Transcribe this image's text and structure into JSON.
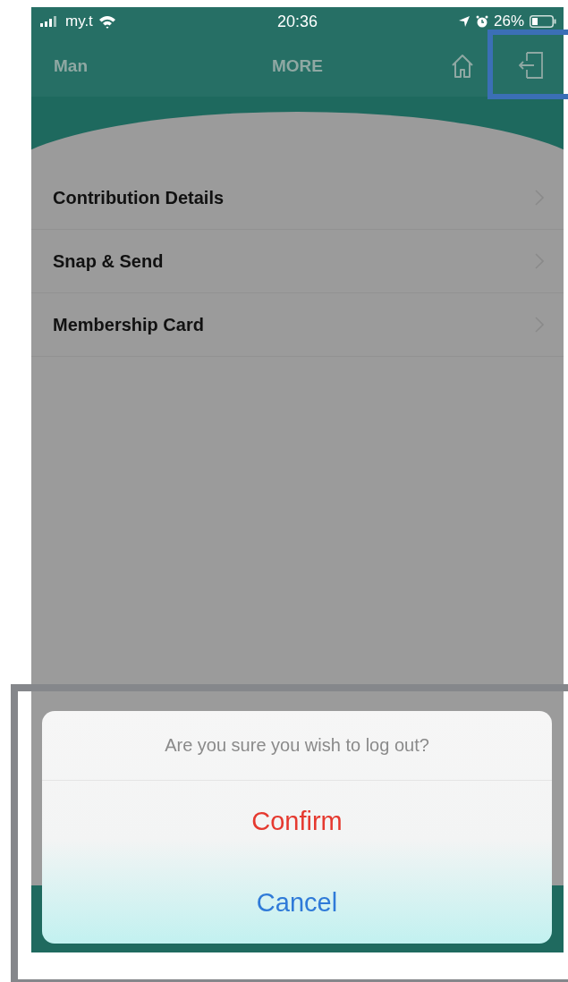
{
  "status_bar": {
    "carrier": "my.t",
    "time": "20:36",
    "battery": "26%"
  },
  "header": {
    "back_label": "Man",
    "title": "MORE"
  },
  "menu_items": [
    {
      "label": "Contribution Details"
    },
    {
      "label": "Snap & Send"
    },
    {
      "label": "Membership Card"
    }
  ],
  "dialog": {
    "message": "Are you sure you wish to log out?",
    "actions": [
      {
        "label": "Confirm",
        "kind": "destructive"
      },
      {
        "label": "Cancel",
        "kind": "cancel"
      }
    ]
  },
  "annotations": [
    {
      "kind": "logout-highlight",
      "color": "#3b6fb6"
    },
    {
      "kind": "dialog-highlight",
      "color": "#85878b"
    }
  ]
}
